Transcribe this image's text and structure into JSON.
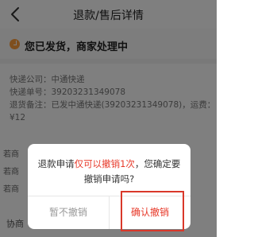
{
  "header": {
    "title": "退款/售后详情"
  },
  "status": {
    "text": "您已发货，商家处理中",
    "icon": "check-circle-icon",
    "color": "#ff9e3d"
  },
  "logistics": {
    "lines": [
      "快递公司：中通快递",
      "快递单号：39203231349078",
      "退货备注：已发中通快递(39203231349078)，运费：",
      "¥12"
    ]
  },
  "background_rows": [
    "若商",
    "若商",
    "若商"
  ],
  "bottom": {
    "left_text": "协商"
  },
  "dialog": {
    "message_part1": "退款申请",
    "message_highlight": "仅可以撤销1次",
    "message_part2": "，您确定要撤销申请吗?",
    "cancel_label": "暂不撤销",
    "confirm_label": "确认撤销",
    "highlight_color": "#e73828"
  }
}
